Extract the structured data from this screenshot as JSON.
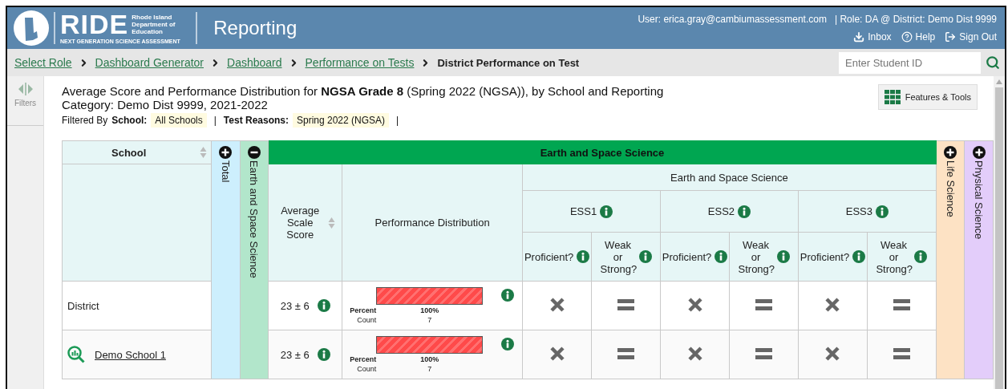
{
  "header": {
    "logo": {
      "wordmark": "RIDE",
      "agency": "Rhode Island Department of Education",
      "tagline": "NEXT GENERATION SCIENCE ASSESSMENT"
    },
    "app_title": "Reporting",
    "user": "User: erica.gray@cambiumassessment.com",
    "role": "| Role: DA @ District: Demo Dist 9999",
    "links": [
      {
        "label": "Inbox",
        "kind": "inbox"
      },
      {
        "label": "Help",
        "kind": "help"
      },
      {
        "label": "Sign Out",
        "kind": "signout"
      }
    ]
  },
  "breadcrumbs": [
    {
      "label": "Select Role",
      "current": false
    },
    {
      "label": "Dashboard Generator",
      "current": false
    },
    {
      "label": "Dashboard",
      "current": false
    },
    {
      "label": "Performance on Tests",
      "current": false
    },
    {
      "label": "District Performance on Test",
      "current": true
    }
  ],
  "student_search": {
    "placeholder": "Enter Student ID"
  },
  "filters_panel": {
    "label": "Filters",
    "disabled": true
  },
  "report": {
    "title": "Average Score and Performance Distribution for **NGSA Grade 8** (Spring 2022 (NGSA)), by School and Reporting Category: Demo Dist 9999, 2021-2022",
    "filtered_by": "Filtered By",
    "separator": "|",
    "filters": [
      {
        "label": "School:",
        "value": "All Schools"
      },
      {
        "label": "Test Reasons:",
        "value": "Spring 2022 (NGSA)"
      }
    ]
  },
  "features_button": "Features & Tools",
  "table": {
    "school_header": {
      "label": "School",
      "sortable": true
    },
    "groups": [
      {
        "label": "Total",
        "expanded": false,
        "color": "#cdeffd"
      },
      {
        "label": "Earth and Space Science",
        "expanded": true,
        "color": "#b2e6cb"
      },
      {
        "label": "Life Science",
        "expanded": false,
        "color": "#fde2c4"
      },
      {
        "label": "Physical Science",
        "expanded": false,
        "color": "#e3cdfa"
      }
    ],
    "detail": {
      "banner": "Earth and Space Science",
      "subheader": "Earth and Space Science",
      "score_header": {
        "label": "Average Scale Score",
        "sortable": true
      },
      "distribution_header": "Performance Distribution",
      "standards": [
        {
          "label": "ESS1",
          "columns": [
            "Proficient?",
            "Weak or Strong?"
          ]
        },
        {
          "label": "ESS2",
          "columns": [
            "Proficient?",
            "Weak or Strong?"
          ]
        },
        {
          "label": "ESS3",
          "columns": [
            "Proficient?",
            "Weak or Strong?"
          ]
        }
      ]
    },
    "rows": [
      {
        "name": "District",
        "link": false,
        "score": "23 ± 6",
        "distribution": {
          "level": 1,
          "percent_label": "Percent",
          "percent": "100%",
          "count_label": "Count",
          "count": "7"
        },
        "results": [
          {
            "kind": "cross"
          },
          {
            "kind": "equal"
          },
          {
            "kind": "cross"
          },
          {
            "kind": "equal"
          },
          {
            "kind": "cross"
          },
          {
            "kind": "equal"
          }
        ]
      },
      {
        "name": "Demo School 1",
        "link": true,
        "score": "23 ± 6",
        "distribution": {
          "level": 1,
          "percent_label": "Percent",
          "percent": "100%",
          "count_label": "Count",
          "count": "7"
        },
        "results": [
          {
            "kind": "cross"
          },
          {
            "kind": "equal"
          },
          {
            "kind": "cross"
          },
          {
            "kind": "equal"
          },
          {
            "kind": "cross"
          },
          {
            "kind": "equal"
          }
        ]
      }
    ]
  }
}
